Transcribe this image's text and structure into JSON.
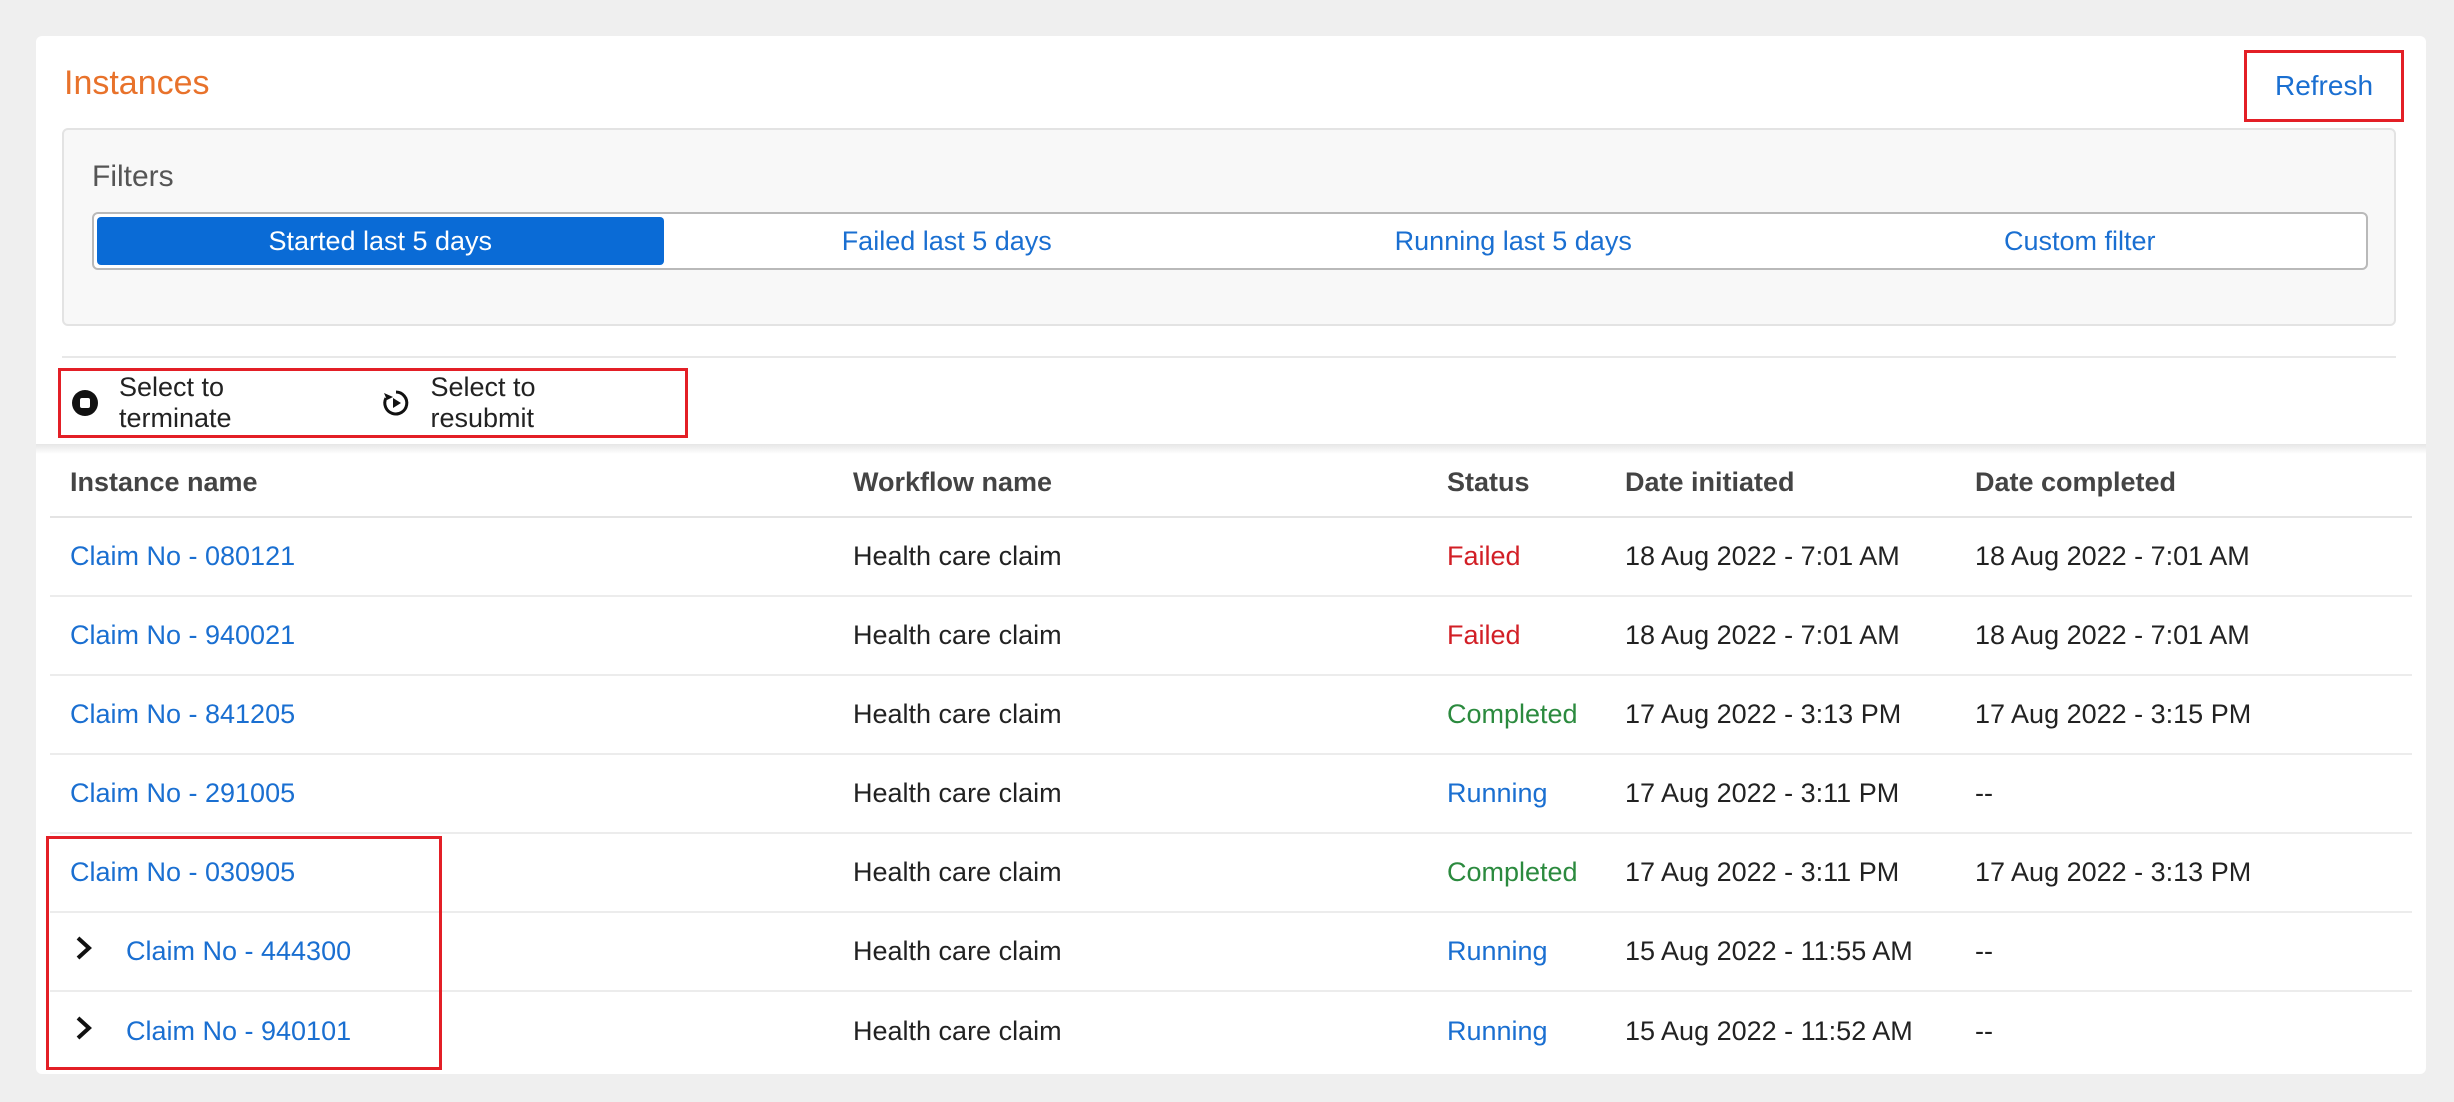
{
  "header": {
    "title": "Instances",
    "refresh_label": "Refresh"
  },
  "filters": {
    "label": "Filters",
    "options": [
      {
        "label": "Started last 5 days",
        "active": true
      },
      {
        "label": "Failed last 5 days",
        "active": false
      },
      {
        "label": "Running last 5 days",
        "active": false
      },
      {
        "label": "Custom filter",
        "active": false
      }
    ]
  },
  "actions": {
    "terminate_label": "Select to terminate",
    "resubmit_label": "Select to resubmit"
  },
  "table": {
    "columns": [
      "Instance name",
      "Workflow name",
      "Status",
      "Date initiated",
      "Date completed"
    ],
    "rows": [
      {
        "name": "Claim No - 080121",
        "workflow": "Health care claim",
        "status": "Failed",
        "initiated": "18 Aug 2022 - 7:01 AM",
        "completed": "18 Aug 2022 - 7:01 AM",
        "expandable": false
      },
      {
        "name": "Claim No - 940021",
        "workflow": "Health care claim",
        "status": "Failed",
        "initiated": "18 Aug 2022 - 7:01 AM",
        "completed": "18 Aug 2022 - 7:01 AM",
        "expandable": false
      },
      {
        "name": "Claim No - 841205",
        "workflow": "Health care claim",
        "status": "Completed",
        "initiated": "17 Aug 2022 - 3:13 PM",
        "completed": "17 Aug 2022 - 3:15 PM",
        "expandable": false
      },
      {
        "name": "Claim No - 291005",
        "workflow": "Health care claim",
        "status": "Running",
        "initiated": "17 Aug 2022 - 3:11 PM",
        "completed": "--",
        "expandable": false
      },
      {
        "name": "Claim No - 030905",
        "workflow": "Health care claim",
        "status": "Completed",
        "initiated": "17 Aug 2022 - 3:11 PM",
        "completed": "17 Aug 2022 - 3:13 PM",
        "expandable": false
      },
      {
        "name": "Claim No - 444300",
        "workflow": "Health care claim",
        "status": "Running",
        "initiated": "15 Aug 2022 - 11:55 AM",
        "completed": "--",
        "expandable": true
      },
      {
        "name": "Claim No - 940101",
        "workflow": "Health care claim",
        "status": "Running",
        "initiated": "15 Aug 2022 - 11:52 AM",
        "completed": "--",
        "expandable": true
      }
    ]
  },
  "icons": {
    "terminate": "stop-circle-icon",
    "resubmit": "replay-circle-icon",
    "expand": "chevron-right-icon"
  },
  "colors": {
    "title": "#e8722b",
    "link": "#1a6fd1",
    "active_filter": "#0a6bd6",
    "failed": "#d21f26",
    "completed": "#2b8a3e",
    "highlight": "#e31f26"
  }
}
